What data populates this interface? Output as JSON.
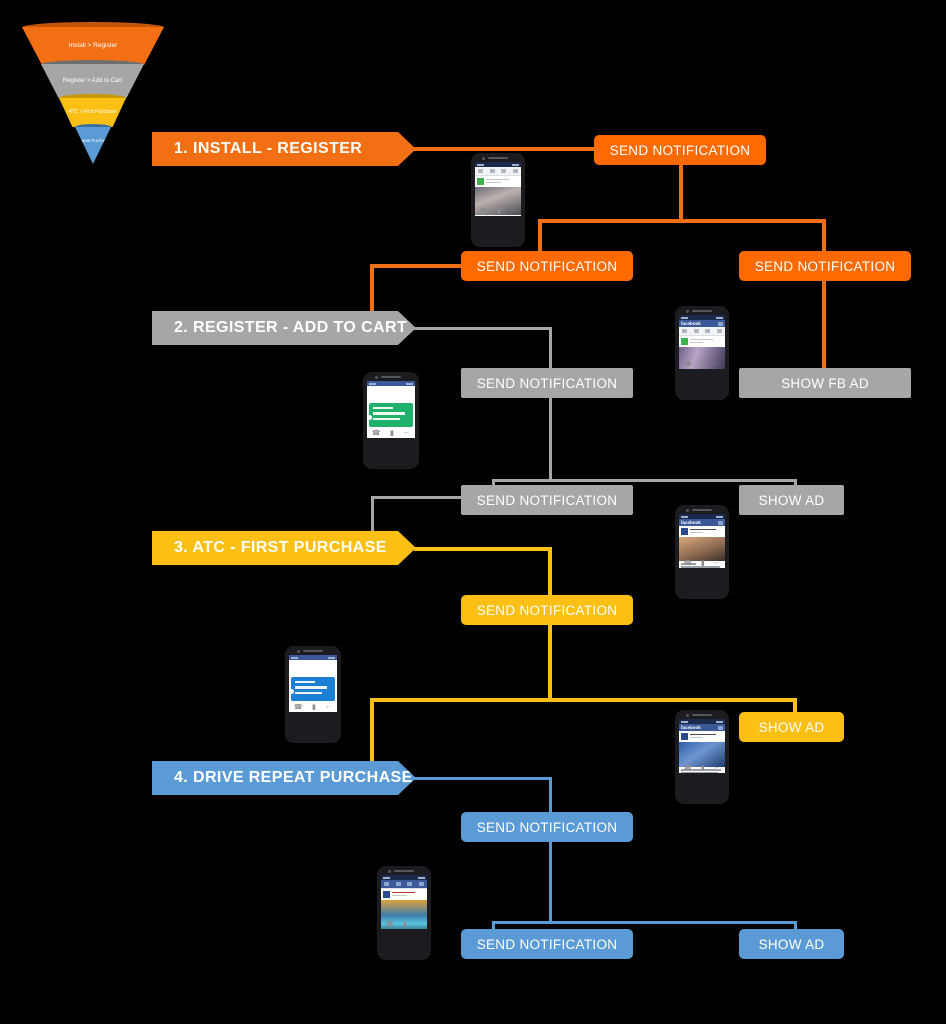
{
  "colors": {
    "background": "#000000",
    "stage1": "#f36f13",
    "stage1_alt": "#ff6a00",
    "stage2": "#a6a6a6",
    "stage3": "#fcbf14",
    "stage4": "#5b9bd5",
    "text_on_color": "#ffffff"
  },
  "funnel": {
    "title": "conversion-funnel",
    "segments": [
      {
        "label": "Install > Register",
        "color": "#f36f13"
      },
      {
        "label": "Register > Add to Cart",
        "color": "#a6a6a6"
      },
      {
        "label": "ATC > First Purchase",
        "color": "#fcbf14"
      },
      {
        "label": "Repeat Purchase",
        "color": "#5b9bd5"
      }
    ]
  },
  "stages": [
    {
      "id": "stage-1",
      "title": "1. INSTALL - REGISTER",
      "color": "#f36f13",
      "nodes": [
        {
          "id": "s1-n1",
          "label": "SEND NOTIFICATION"
        },
        {
          "id": "s1-n2",
          "label": "SEND NOTIFICATION"
        },
        {
          "id": "s1-n3",
          "label": "SEND NOTIFICATION"
        }
      ]
    },
    {
      "id": "stage-2",
      "title": "2. REGISTER - ADD TO CART",
      "color": "#a6a6a6",
      "nodes": [
        {
          "id": "s2-n1",
          "label": "SEND NOTIFICATION"
        },
        {
          "id": "s2-n2",
          "label": "SHOW FB AD"
        },
        {
          "id": "s2-n3",
          "label": "SEND NOTIFICATION"
        },
        {
          "id": "s2-n4",
          "label": "SHOW AD"
        }
      ]
    },
    {
      "id": "stage-3",
      "title": "3. ATC - FIRST PURCHASE",
      "color": "#fcbf14",
      "nodes": [
        {
          "id": "s3-n1",
          "label": "SEND NOTIFICATION"
        },
        {
          "id": "s3-n2",
          "label": "SHOW AD"
        }
      ]
    },
    {
      "id": "stage-4",
      "title": "4. DRIVE REPEAT PURCHASE",
      "color": "#5b9bd5",
      "nodes": [
        {
          "id": "s4-n1",
          "label": "SEND NOTIFICATION"
        },
        {
          "id": "s4-n2",
          "label": "SEND NOTIFICATION"
        },
        {
          "id": "s4-n3",
          "label": "SHOW AD"
        }
      ]
    }
  ],
  "phones": [
    {
      "id": "phone-1",
      "content": "facebook-post-people-photo"
    },
    {
      "id": "phone-2",
      "content": "facebook-feed-phone-ad"
    },
    {
      "id": "phone-3",
      "content": "push-notification-green"
    },
    {
      "id": "phone-4",
      "content": "facebook-feed-desk-ad"
    },
    {
      "id": "phone-5",
      "content": "push-notification-blue"
    },
    {
      "id": "phone-6",
      "content": "facebook-feed-handbag-ad"
    },
    {
      "id": "phone-7",
      "content": "facebook-feed-travel-ad"
    }
  ]
}
